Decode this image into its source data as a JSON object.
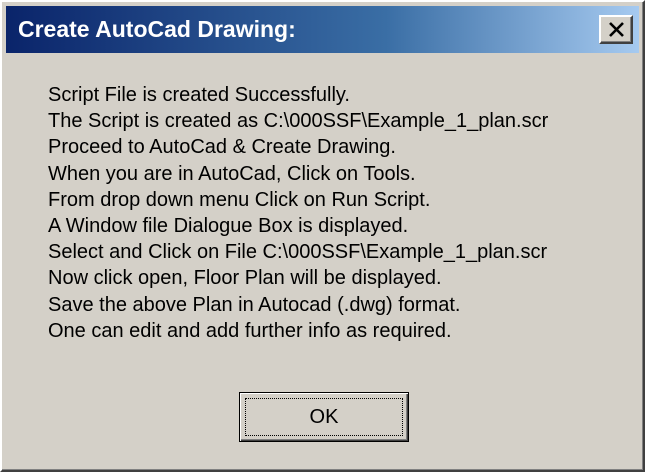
{
  "window": {
    "title": "Create AutoCad Drawing:"
  },
  "icons": {
    "close": "close-icon"
  },
  "message_lines": [
    "Script File is created Successfully.",
    "The Script is created as C:\\000SSF\\Example_1_plan.scr",
    "Proceed to AutoCad & Create Drawing.",
    "When you are in AutoCad, Click on Tools.",
    "From drop down menu Click on Run Script.",
    "A Window file Dialogue Box is displayed.",
    "Select and Click on File C:\\000SSF\\Example_1_plan.scr",
    "Now click open, Floor Plan will be displayed.",
    "Save the above Plan in Autocad (.dwg) format.",
    "One can edit and add further info as required."
  ],
  "buttons": {
    "ok_label": "OK"
  },
  "colors": {
    "title_bar_start": "#0a246a",
    "title_bar_end": "#a6caf0",
    "dialog_face": "#d4d0c8"
  }
}
